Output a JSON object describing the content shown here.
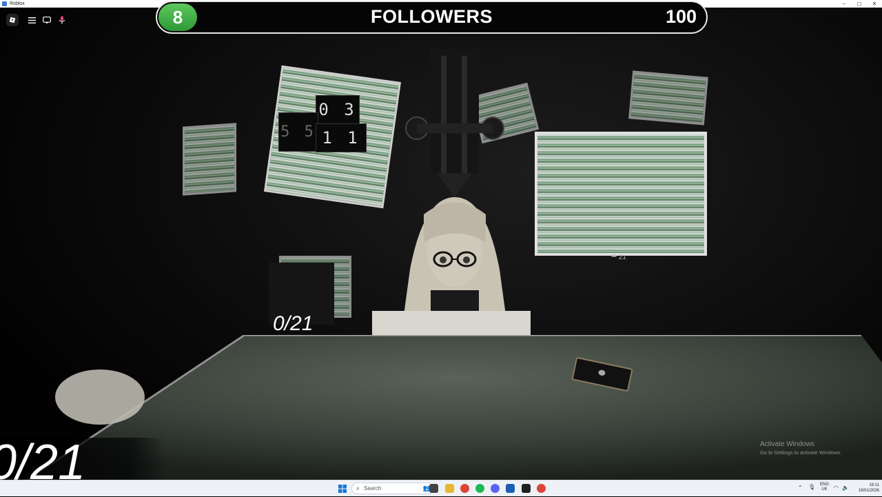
{
  "window": {
    "title": "Roblox",
    "controls": [
      "–",
      "◻",
      "✕"
    ]
  },
  "roblox_menu": {
    "buttons": [
      {
        "name": "roblox-logo",
        "glyph": "◆"
      },
      {
        "name": "menu",
        "glyph": "☰"
      },
      {
        "name": "chat",
        "glyph": "💬"
      },
      {
        "name": "mic",
        "glyph": "🎙"
      }
    ]
  },
  "hud": {
    "followers_count": "8",
    "followers_title": "FOLLOWERS",
    "followers_goal": "100",
    "followers_progress": 0.08,
    "accent_green": "#3fb34a",
    "collect_counter_small": "0/21",
    "collect_counter_large": "0/21"
  },
  "scene": {
    "clock_top": "0 3",
    "clock_mid_left": "5 5",
    "clock_bottom": "1 1",
    "monitor_label": "⯊ 21"
  },
  "watermark": {
    "line1": "Activate Windows",
    "line2": "Go to Settings to activate Windows."
  },
  "taskbar": {
    "search_placeholder": "Search",
    "language_line1": "ENG",
    "language_line2": "UK",
    "time": "16:11",
    "date": "19/01/2026",
    "pinned_icons": [
      "windows-start",
      "file-explorer",
      "chrome",
      "spotify",
      "discord",
      "roblox-studio",
      "roblox",
      "chrome-alt"
    ]
  }
}
